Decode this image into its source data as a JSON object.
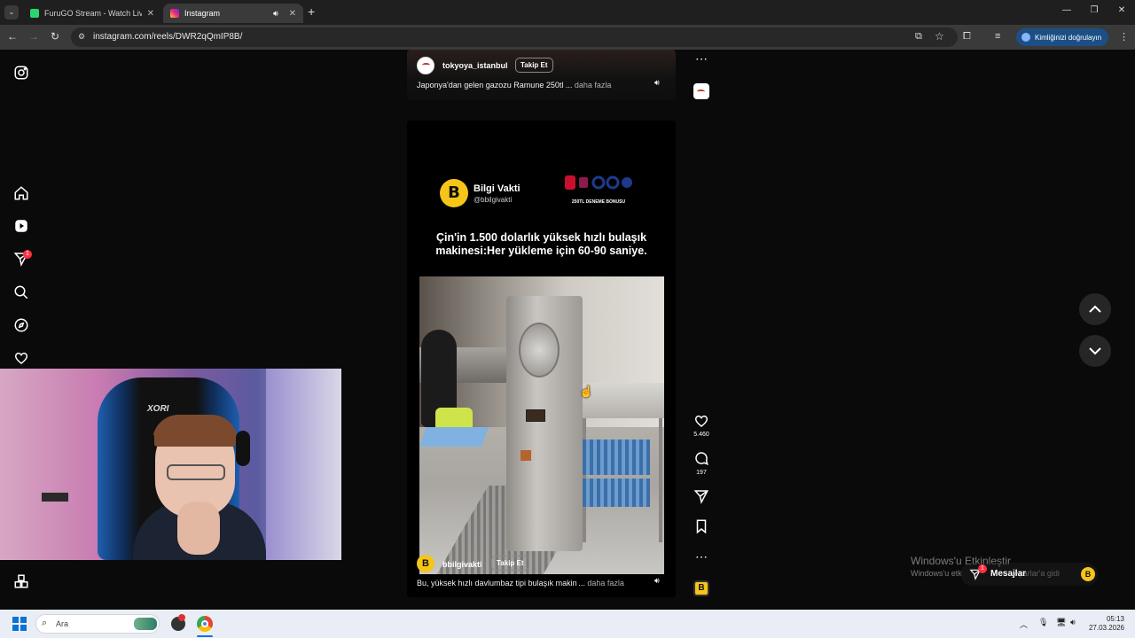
{
  "browser": {
    "tabs": [
      {
        "title": "FuruGO Stream - Watch Live o",
        "close": "✕"
      },
      {
        "title": "Instagram",
        "close": "✕"
      }
    ],
    "new_tab": "+",
    "url": "instagram.com/reels/DWR2qQmIP8B/",
    "verify_label": "Kimliğinizi doğrulayın"
  },
  "sidebar": {
    "notification_count": "1"
  },
  "reel_top": {
    "username": "tokyoya_istanbul",
    "follow_label": "Takip Et",
    "caption": "Japonya'dan gelen gazozu Ramune 250tl ...",
    "more_label": "daha fazla"
  },
  "reel_main": {
    "brand_name": "Bilgi Vakti",
    "brand_handle": "@bbilgivakti",
    "sponsor_sub": "250TL DENEME BONUSU",
    "headline_line1": "Çin'in 1.500 dolarlık yüksek hızlı bulaşık",
    "headline_line2": "makinesi:Her yükleme için 60-90 saniye.",
    "username": "bbilgivakti",
    "follow_label": "Takip Et",
    "caption": "Bu, yüksek hızlı davlumbaz tipi bulaşık makin ...",
    "more_label": "daha fazla",
    "likes": "5.460",
    "comments": "197"
  },
  "watermark": {
    "line1": "Windows'u Etkinleştir",
    "line2": "Windows'u etk",
    "line2_tail": "Ayarlar'a gidi"
  },
  "messages": {
    "label": "Mesajlar",
    "count": "1"
  },
  "taskbar": {
    "search_placeholder": "Ara",
    "time": "05:13",
    "date": "27.03.2026"
  },
  "colors": {
    "instagram_badge": "#ff3040",
    "verify_button": "#1c4f86",
    "brand_yellow": "#f5c518"
  }
}
